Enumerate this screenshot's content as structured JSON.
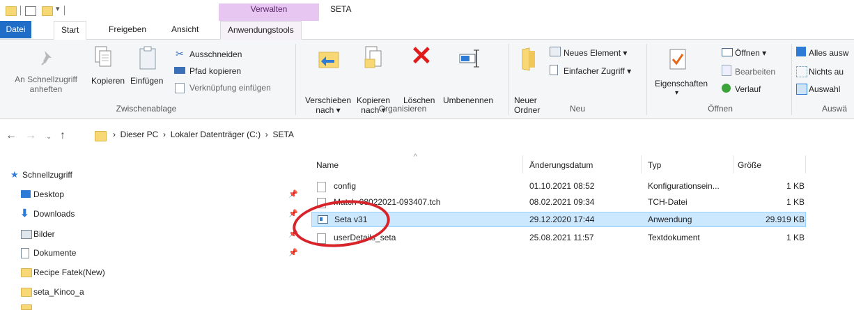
{
  "window": {
    "contextual_group": "Verwalten",
    "title": "SETA"
  },
  "tabs": {
    "datei": "Datei",
    "start": "Start",
    "freigeben": "Freigeben",
    "ansicht": "Ansicht",
    "anwendungstools": "Anwendungstools"
  },
  "ribbon": {
    "zwischenablage": {
      "pin_label_1": "An Schnellzugriff",
      "pin_label_2": "anheften",
      "copy": "Kopieren",
      "paste": "Einfügen",
      "cut": "Ausschneiden",
      "copy_path": "Pfad kopieren",
      "paste_shortcut": "Verknüpfung einfügen",
      "group": "Zwischenablage"
    },
    "organisieren": {
      "move_1": "Verschieben",
      "move_2": "nach ▾",
      "copyto_1": "Kopieren",
      "copyto_2": "nach ▾",
      "delete": "Löschen",
      "rename": "Umbenennen",
      "group": "Organisieren"
    },
    "neu": {
      "folder_1": "Neuer",
      "folder_2": "Ordner",
      "new_item": "Neues Element ▾",
      "easy_access": "Einfacher Zugriff ▾",
      "group": "Neu"
    },
    "oeffnen": {
      "properties": "Eigenschaften",
      "properties_arrow": "▾",
      "open": "Öffnen ▾",
      "edit": "Bearbeiten",
      "history": "Verlauf",
      "group": "Öffnen"
    },
    "auswaehlen": {
      "select_all": "Alles ausw",
      "select_none": "Nichts au",
      "invert": "Auswahl",
      "group": "Auswä"
    }
  },
  "breadcrumb": {
    "pc": "Dieser PC",
    "drive": "Lokaler Datenträger (C:)",
    "folder": "SETA"
  },
  "navpane": {
    "quick_access": "Schnellzugriff",
    "items": [
      "Desktop",
      "Downloads",
      "Bilder",
      "Dokumente",
      "Recipe Fatek(New)",
      "seta_Kinco_a"
    ]
  },
  "columns": {
    "name": "Name",
    "date": "Änderungsdatum",
    "type": "Typ",
    "size": "Größe"
  },
  "files": [
    {
      "name": "config",
      "date": "01.10.2021 08:52",
      "type": "Konfigurationsein...",
      "size": "1 KB"
    },
    {
      "name": "Match-08022021-093407.tch",
      "date": "08.02.2021 09:34",
      "type": "TCH-Datei",
      "size": "1 KB"
    },
    {
      "name": "Seta v31",
      "date": "29.12.2020 17:44",
      "type": "Anwendung",
      "size": "29.919 KB"
    },
    {
      "name": "userDetails_seta",
      "date": "25.08.2021 11:57",
      "type": "Textdokument",
      "size": "1 KB"
    }
  ]
}
